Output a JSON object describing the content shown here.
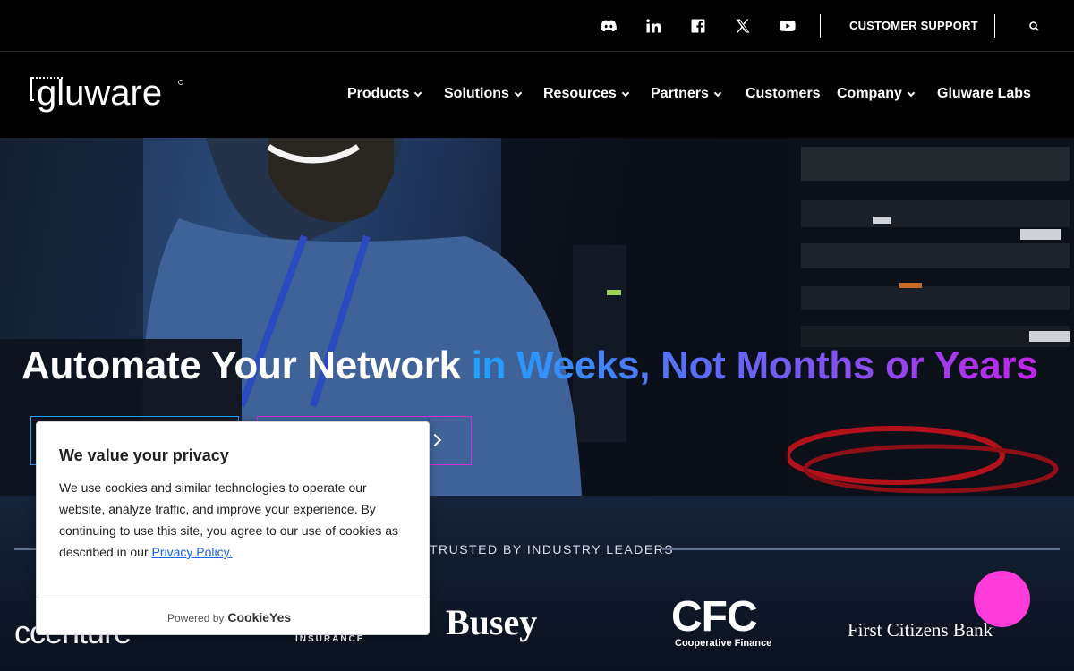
{
  "topbar": {
    "social": [
      "discord-icon",
      "linkedin-icon",
      "facebook-icon",
      "x-twitter-icon",
      "youtube-icon"
    ],
    "support_label": "CUSTOMER SUPPORT"
  },
  "brand": {
    "logo_text": "gluware"
  },
  "nav": {
    "items": [
      {
        "label": "Products",
        "has_dropdown": true
      },
      {
        "label": "Solutions",
        "has_dropdown": true
      },
      {
        "label": "Resources",
        "has_dropdown": true
      },
      {
        "label": "Partners",
        "has_dropdown": true
      },
      {
        "label": "Customers",
        "has_dropdown": false
      },
      {
        "label": "Company",
        "has_dropdown": true
      },
      {
        "label": "Gluware Labs",
        "has_dropdown": false
      }
    ]
  },
  "hero": {
    "title_plain": "Automate Your Network ",
    "title_highlight": "in Weeks, Not Months or Years"
  },
  "trusted": {
    "label": "TRUSTED BY INDUSTRY LEADERS",
    "clients": [
      "ccenture",
      "Busey",
      "CFC",
      "Cooperative Finance",
      "First Citizens Bank",
      "INSURANCE"
    ]
  },
  "cookie": {
    "title": "We value your privacy",
    "body": "We use cookies and similar technologies to operate our website, analyze traffic, and improve your experience. By continuing to use this site, you agree to our use of cookies as described in our ",
    "link": "Privacy Policy.",
    "powered_by": "Powered by",
    "brand": "CookieYes"
  },
  "colors": {
    "accent_blue": "#1fa2ff",
    "accent_magenta": "#d52bd5",
    "chat_bubble": "#ff3bd9",
    "link": "#1863dc"
  }
}
